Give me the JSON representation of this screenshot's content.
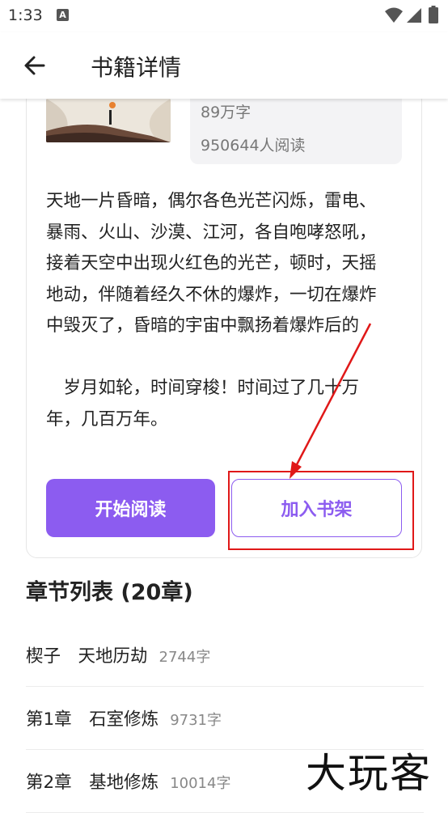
{
  "status_bar": {
    "time": "1:33",
    "notification_glyph": "A"
  },
  "header": {
    "title": "书籍详情",
    "back_icon": "arrow-left-icon"
  },
  "book": {
    "words": "89万字",
    "readers": "950644人阅读",
    "intro": "天地一片昏暗，偶尔各色光芒闪烁，雷电、暴雨、火山、沙漠、江河，各自咆哮怒吼，接着天空中出现火红色的光芒，顿时，天摇地动，伴随着经久不休的爆炸，一切在爆炸中毁灭了，昏暗的宇宙中飘扬着爆炸后的\n\n　岁月如轮，时间穿梭！时间过了几十万年，几百万年。"
  },
  "actions": {
    "start_reading": "开始阅读",
    "add_to_shelf": "加入书架"
  },
  "chapters": {
    "title": "章节列表 (20章)",
    "items": [
      {
        "name": "楔子　天地历劫",
        "count": "2744字"
      },
      {
        "name": "第1章　石室修炼",
        "count": "9731字"
      },
      {
        "name": "第2章　基地修炼",
        "count": "10014字"
      }
    ]
  },
  "watermark": "大玩客",
  "colors": {
    "accent": "#8c5cf0",
    "annotation_red": "#e01818"
  }
}
